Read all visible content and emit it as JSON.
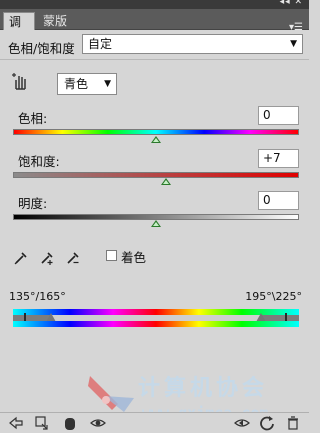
{
  "panel": {
    "tabs": [
      {
        "label": "调整"
      },
      {
        "label": "蒙版"
      }
    ]
  },
  "preset": {
    "label": "色相/饱和度",
    "value": "自定"
  },
  "channel": {
    "value": "青色"
  },
  "hue": {
    "label": "色相:",
    "value": "0",
    "level": 0.5
  },
  "saturation": {
    "label": "饱和度:",
    "value": "+7",
    "level": 0.535
  },
  "lightness": {
    "label": "明度:",
    "value": "0",
    "level": 0.5
  },
  "colorize": {
    "label": "着色"
  },
  "range": {
    "left": "135°/165°",
    "right": "195°\\225°"
  },
  "watermark": {
    "title": "计算机协会",
    "url": "www.gxjmca.com"
  },
  "icons": {
    "hand": "hand-target-icon",
    "eyedropper": "eyedropper-icon",
    "eyedropper_add": "eyedropper-plus-icon",
    "eyedropper_subtract": "eyedropper-minus-icon",
    "back": "back-arrow-icon",
    "clip": "clip-to-layer-icon",
    "mask": "mask-icon",
    "eye": "visibility-eye-icon",
    "view_previous": "view-previous-icon",
    "reset": "reset-icon",
    "delete": "trash-icon"
  }
}
